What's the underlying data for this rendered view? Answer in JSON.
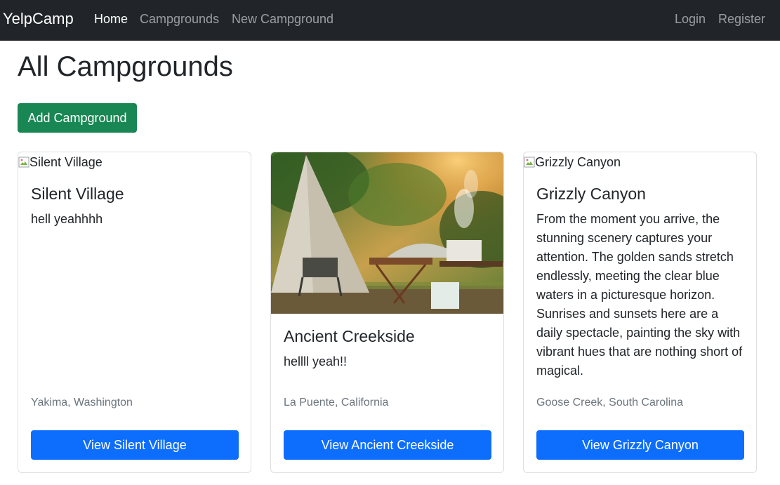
{
  "nav": {
    "brand": "YelpCamp",
    "links": [
      "Home",
      "Campgrounds",
      "New Campground"
    ],
    "auth": [
      "Login",
      "Register"
    ]
  },
  "page": {
    "title": "All Campgrounds",
    "add_button": "Add Campground"
  },
  "cards": [
    {
      "image_alt": "Silent Village",
      "title": "Silent Village",
      "description": "hell yeahhhh",
      "location": "Yakima, Washington",
      "button": "View Silent Village"
    },
    {
      "image_alt": "",
      "title": "Ancient Creekside",
      "description": "hellll yeah!!",
      "location": "La Puente, California",
      "button": "View Ancient Creekside"
    },
    {
      "image_alt": "Grizzly Canyon",
      "title": "Grizzly Canyon",
      "description": "From the moment you arrive, the stunning scenery captures your attention. The golden sands stretch endlessly, meeting the clear blue waters in a picturesque horizon. Sunrises and sunsets here are a daily spectacle, painting the sky with vibrant hues that are nothing short of magical.",
      "location": "Goose Creek, South Carolina",
      "button": "View Grizzly Canyon"
    }
  ],
  "colors": {
    "navbar": "#212529",
    "add_button": "#198754",
    "view_button": "#0d6efd",
    "location_text": "#6c757d"
  }
}
